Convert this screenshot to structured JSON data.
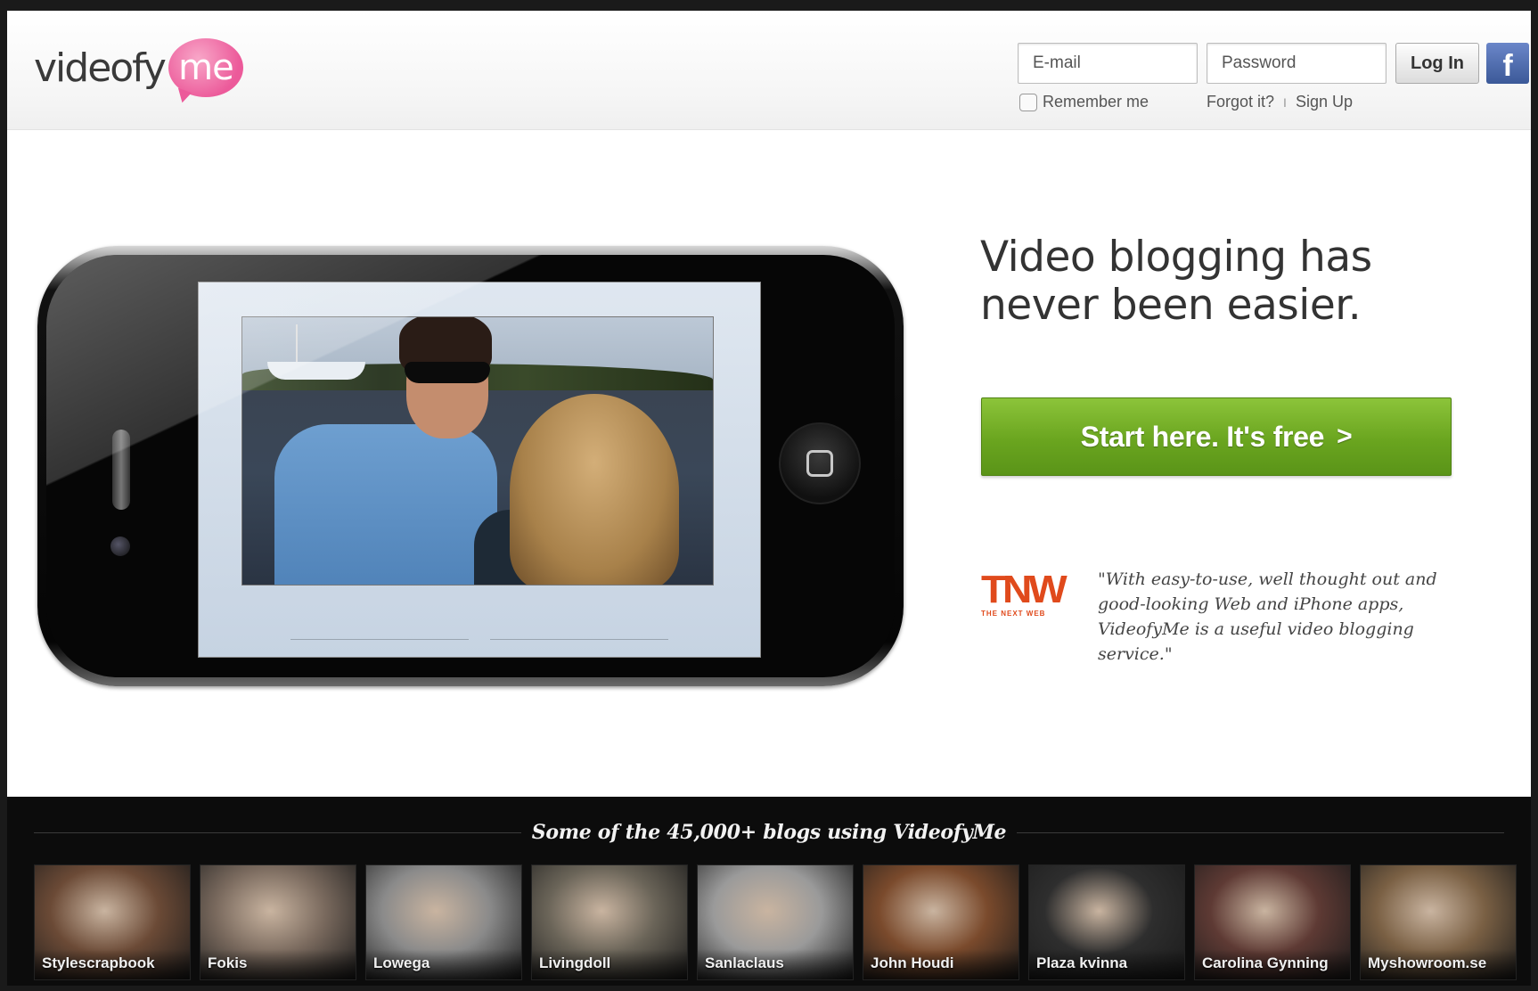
{
  "brand": {
    "logo_word": "videofy",
    "logo_bubble": "me",
    "accent_pink": "#ec5a9a"
  },
  "header": {
    "email_placeholder": "E-mail",
    "password_placeholder": "Password",
    "login_label": "Log In",
    "facebook_glyph": "f",
    "facebook_icon": "facebook-icon",
    "remember_label": "Remember me",
    "forgot_label": "Forgot it?",
    "separator": "I",
    "signup_label": "Sign Up"
  },
  "hero": {
    "title": "Video blogging has never been easier.",
    "cta_label": "Start here. It's free",
    "cta_chevron": ">",
    "cta_color": "#6aa51f",
    "tnw_letters": "TNW",
    "tnw_sub": "THE NEXT WEB",
    "quote": "\"With easy-to-use, well thought out and good-looking Web and iPhone apps, VideofyMe is a useful video blogging service.\""
  },
  "blogs": {
    "heading": "Some of the 45,000+ blogs using VideofyMe",
    "items": [
      {
        "label": "Stylescrapbook",
        "tint": "#6b4a36"
      },
      {
        "label": "Fokis",
        "tint": "#7a6a5e"
      },
      {
        "label": "Lowega",
        "tint": "#8a8a8a"
      },
      {
        "label": "Livingdoll",
        "tint": "#6a6458"
      },
      {
        "label": "Sanlaclaus",
        "tint": "#9a9a9a"
      },
      {
        "label": "John Houdi",
        "tint": "#7a4a2c"
      },
      {
        "label": "Plaza kvinna",
        "tint": "#2e2e2e"
      },
      {
        "label": "Carolina Gynning",
        "tint": "#5e3a34"
      },
      {
        "label": "Myshowroom.se",
        "tint": "#7a6044"
      }
    ]
  }
}
